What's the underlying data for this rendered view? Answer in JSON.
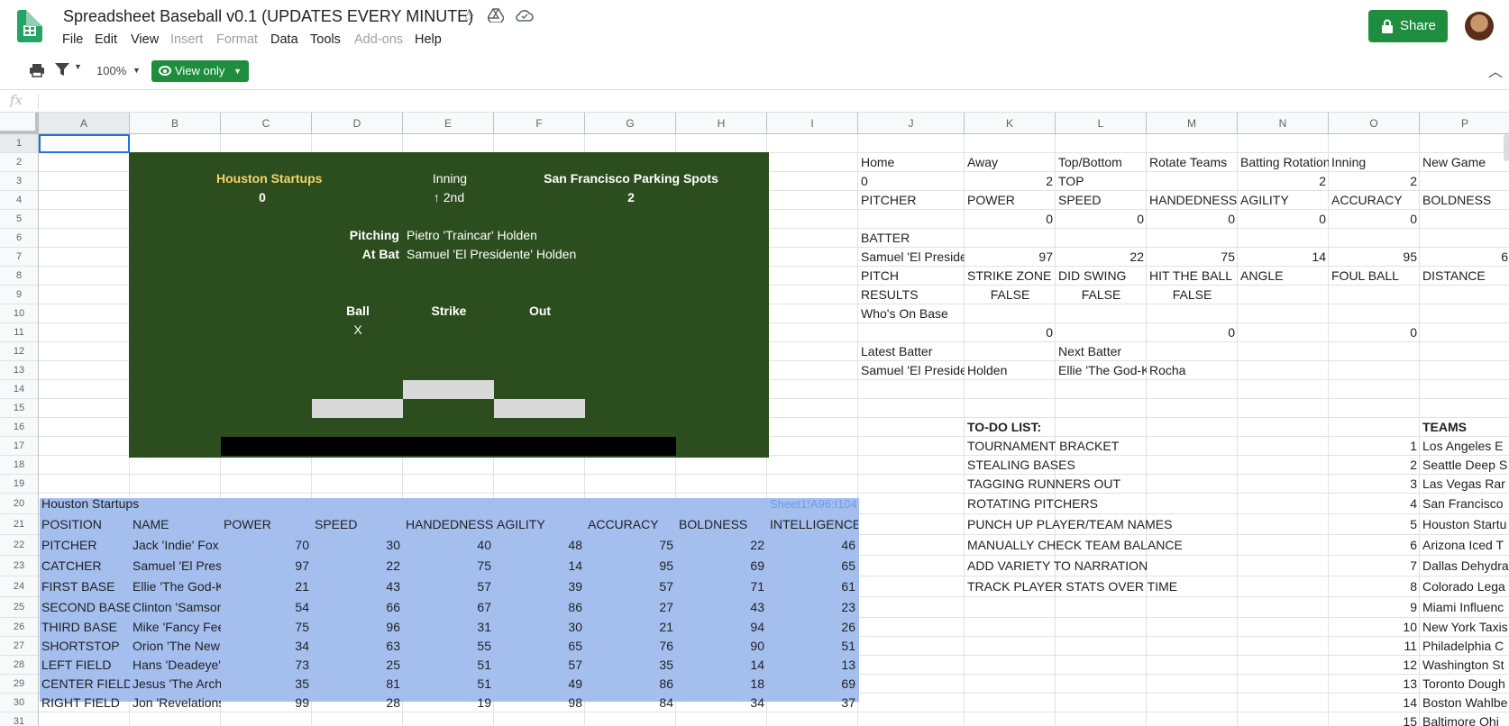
{
  "app": {
    "doc_title": "Spreadsheet Baseball v0.1 (UPDATES EVERY MINUTE)",
    "menus": [
      "File",
      "Edit",
      "View",
      "Insert",
      "Format",
      "Data",
      "Tools",
      "Add-ons",
      "Help"
    ],
    "share_label": "Share",
    "zoom": "100%",
    "view_only_label": "View only",
    "fx_label": "fx"
  },
  "columns": [
    "A",
    "B",
    "C",
    "D",
    "E",
    "F",
    "G",
    "H",
    "I",
    "J",
    "K",
    "L",
    "M",
    "N",
    "O",
    "P"
  ],
  "rows": [
    "1",
    "2",
    "3",
    "4",
    "5",
    "6",
    "7",
    "8",
    "9",
    "10",
    "11",
    "12",
    "13",
    "14",
    "15",
    "16",
    "17",
    "18",
    "19",
    "20",
    "21",
    "22",
    "23",
    "24",
    "25",
    "26",
    "27",
    "28",
    "29",
    "30",
    "31"
  ],
  "scoreboard": {
    "home_team": "Houston Startups",
    "home_score": "0",
    "inning_label": "Inning",
    "inning_value": "↑ 2nd",
    "away_team": "San Francisco Parking Spots",
    "away_score": "2",
    "pitching_label": "Pitching",
    "pitcher": "Pietro 'Traincar' Holden",
    "at_bat_label": "At Bat",
    "batter": "Samuel 'El Presidente' Holden",
    "ball_label": "Ball",
    "strike_label": "Strike",
    "out_label": "Out",
    "ball_mark": "X"
  },
  "state": {
    "row2": [
      "Home",
      "Away",
      "Top/Bottom",
      "Rotate Teams",
      "Batting Rotation",
      "Inning",
      "New Game"
    ],
    "row3": [
      "0",
      "2",
      "TOP",
      "",
      "2",
      "2",
      ""
    ],
    "row4": [
      "PITCHER",
      "POWER",
      "SPEED",
      "HANDEDNESS",
      "AGILITY",
      "ACCURACY",
      "BOLDNESS"
    ],
    "row5": [
      "",
      "0",
      "0",
      "0",
      "0",
      "0",
      ""
    ],
    "row6": [
      "BATTER"
    ],
    "row7": [
      "Samuel 'El Preside",
      "97",
      "22",
      "75",
      "14",
      "95",
      "6"
    ],
    "row8": [
      "PITCH",
      "STRIKE ZONE",
      "DID SWING",
      "HIT THE BALL",
      "ANGLE",
      "FOUL BALL",
      "DISTANCE"
    ],
    "row9": [
      "RESULTS",
      "FALSE",
      "FALSE",
      "FALSE",
      "",
      "",
      ""
    ],
    "row10": [
      "Who's On Base"
    ],
    "row11": [
      "",
      "0",
      "",
      "0",
      "",
      "0",
      ""
    ],
    "row12": [
      "Latest Batter",
      "",
      "Next Batter"
    ],
    "row13": [
      "Samuel 'El Preside",
      "Holden",
      "Ellie 'The God-K",
      "Rocha"
    ]
  },
  "todo": {
    "title": "TO-DO LIST:",
    "items": [
      "TOURNAMENT BRACKET",
      "STEALING BASES",
      "TAGGING RUNNERS OUT",
      "ROTATING PITCHERS",
      "PUNCH UP PLAYER/TEAM NAMES",
      "MANUALLY CHECK TEAM BALANCE",
      "ADD VARIETY TO NARRATION",
      "TRACK PLAYER STATS OVER TIME"
    ]
  },
  "teams": {
    "title": "TEAMS",
    "list": [
      {
        "n": "1",
        "name": "Los Angeles E"
      },
      {
        "n": "2",
        "name": "Seattle Deep S"
      },
      {
        "n": "3",
        "name": "Las Vegas Rar"
      },
      {
        "n": "4",
        "name": "San Francisco"
      },
      {
        "n": "5",
        "name": "Houston Startu"
      },
      {
        "n": "6",
        "name": "Arizona Iced T"
      },
      {
        "n": "7",
        "name": "Dallas Dehydra"
      },
      {
        "n": "8",
        "name": "Colorado Lega"
      },
      {
        "n": "9",
        "name": "Miami Influenc"
      },
      {
        "n": "10",
        "name": "New York Taxis"
      },
      {
        "n": "11",
        "name": "Philadelphia C"
      },
      {
        "n": "12",
        "name": "Washington St"
      },
      {
        "n": "13",
        "name": "Toronto Dough"
      },
      {
        "n": "14",
        "name": "Boston Wahlbe"
      },
      {
        "n": "15",
        "name": "Baltimore Ohi"
      }
    ]
  },
  "roster": {
    "team": "Houston Startups",
    "ref": "Sheet1!A96:I104",
    "headers": [
      "POSITION",
      "NAME",
      "POWER",
      "SPEED",
      "HANDEDNESS",
      "AGILITY",
      "ACCURACY",
      "BOLDNESS",
      "INTELLIGENCE"
    ],
    "players": [
      [
        "PITCHER",
        "Jack 'Indie' Fox",
        "70",
        "30",
        "40",
        "48",
        "75",
        "22",
        "46"
      ],
      [
        "CATCHER",
        "Samuel 'El Presi",
        "97",
        "22",
        "75",
        "14",
        "95",
        "69",
        "65"
      ],
      [
        "FIRST BASE",
        "Ellie 'The God-K",
        "21",
        "43",
        "57",
        "39",
        "57",
        "71",
        "61"
      ],
      [
        "SECOND BASE",
        "Clinton 'Samson",
        "54",
        "66",
        "67",
        "86",
        "27",
        "43",
        "23"
      ],
      [
        "THIRD BASE",
        "Mike 'Fancy Fee",
        "75",
        "96",
        "31",
        "30",
        "21",
        "94",
        "26"
      ],
      [
        "SHORTSTOP",
        "Orion 'The New '",
        "34",
        "63",
        "55",
        "65",
        "76",
        "90",
        "51"
      ],
      [
        "LEFT FIELD",
        "Hans 'Deadeye'",
        "73",
        "25",
        "51",
        "57",
        "35",
        "14",
        "13"
      ],
      [
        "CENTER FIELD",
        "Jesus 'The Archi",
        "35",
        "81",
        "51",
        "49",
        "86",
        "18",
        "69"
      ],
      [
        "RIGHT FIELD",
        "Jon 'Revelations",
        "99",
        "28",
        "19",
        "98",
        "84",
        "34",
        "37"
      ]
    ]
  }
}
